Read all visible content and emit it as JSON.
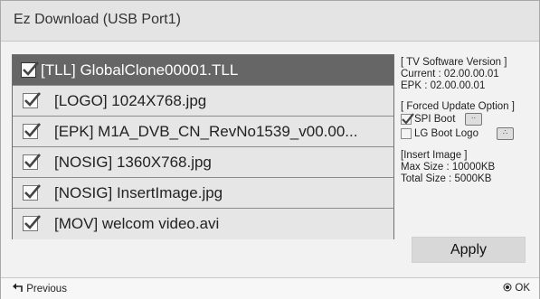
{
  "window": {
    "title": "Ez Download (USB Port1)"
  },
  "files": [
    {
      "name": "[TLL] GlobalClone00001.TLL",
      "checked": true,
      "selected": true
    },
    {
      "name": "[LOGO] 1024X768.jpg",
      "checked": true,
      "selected": false
    },
    {
      "name": "[EPK] M1A_DVB_CN_RevNo1539_v00.00...",
      "checked": true,
      "selected": false
    },
    {
      "name": "[NOSIG] 1360X768.jpg",
      "checked": true,
      "selected": false
    },
    {
      "name": "[NOSIG] InsertImage.jpg",
      "checked": true,
      "selected": false
    },
    {
      "name": "[MOV] welcom video.avi",
      "checked": true,
      "selected": false
    }
  ],
  "info": {
    "sw_header": "[ TV Software Version ]",
    "current": "Current : 02.00.00.01",
    "epk": "EPK : 02.00.00.01",
    "forced_header": "[ Forced Update Option ]",
    "spi_boot": "SPI Boot",
    "spi_boot_checked": true,
    "spi_btn": "··",
    "lg_boot_logo": "LG Boot Logo",
    "lg_boot_logo_checked": false,
    "lg_btn": "∴",
    "insert_header": "[Insert Image ]",
    "max_size": "Max Size : 10000KB",
    "total_size": "Total Size : 5000KB"
  },
  "apply_label": "Apply",
  "footer": {
    "previous": "Previous",
    "ok": "OK"
  },
  "icons": {
    "previous": "return-arrow-icon",
    "ok": "ok-dot-icon",
    "check": "checkmark-icon"
  },
  "colors": {
    "selected_row": "#666666",
    "row": "#e6e6e6",
    "window": "#f2f2f2"
  }
}
